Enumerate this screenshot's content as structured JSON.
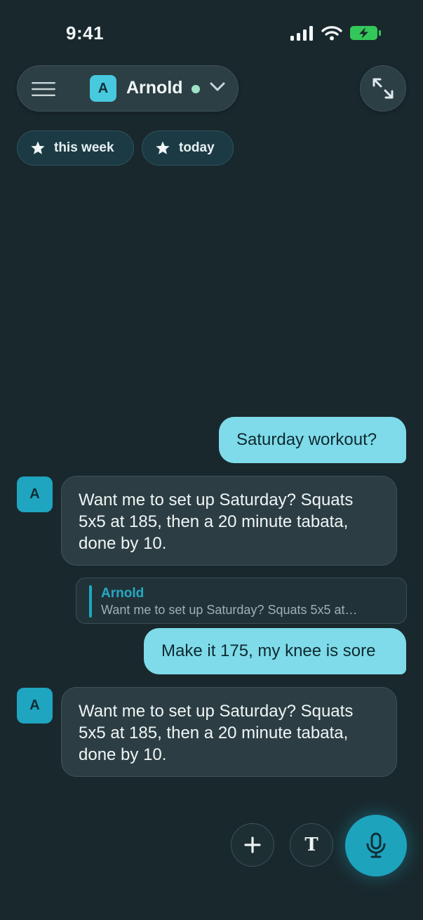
{
  "status_bar": {
    "time": "9:41"
  },
  "header": {
    "agent_initial": "A",
    "agent_name": "Arnold"
  },
  "chips": [
    {
      "label": "this week",
      "icon": "star-icon"
    },
    {
      "label": "today",
      "icon": "star-icon"
    }
  ],
  "messages": {
    "user_1": "Saturday workout?",
    "bot_1_avatar": "A",
    "bot_1": "Want me to set up Saturday? Squats 5x5 at 185, then a 20 minute tabata, done by 10.",
    "reply_author": "Arnold",
    "reply_text": "Want me to set up Saturday? Squats 5x5 at…",
    "user_2": "Make it 175, my knee is sore",
    "bot_2_avatar": "A",
    "bot_2": "Want me to set up Saturday? Squats 5x5 at 185, then a 20 minute tabata, done by 10."
  },
  "actions": {
    "text_label": "T"
  },
  "colors": {
    "background": "#19282d",
    "accent": "#1ea3bd",
    "user_bubble": "#7fdbe9",
    "bot_bubble": "#2c3e43",
    "online": "#9fe3c6",
    "battery": "#34c759"
  }
}
